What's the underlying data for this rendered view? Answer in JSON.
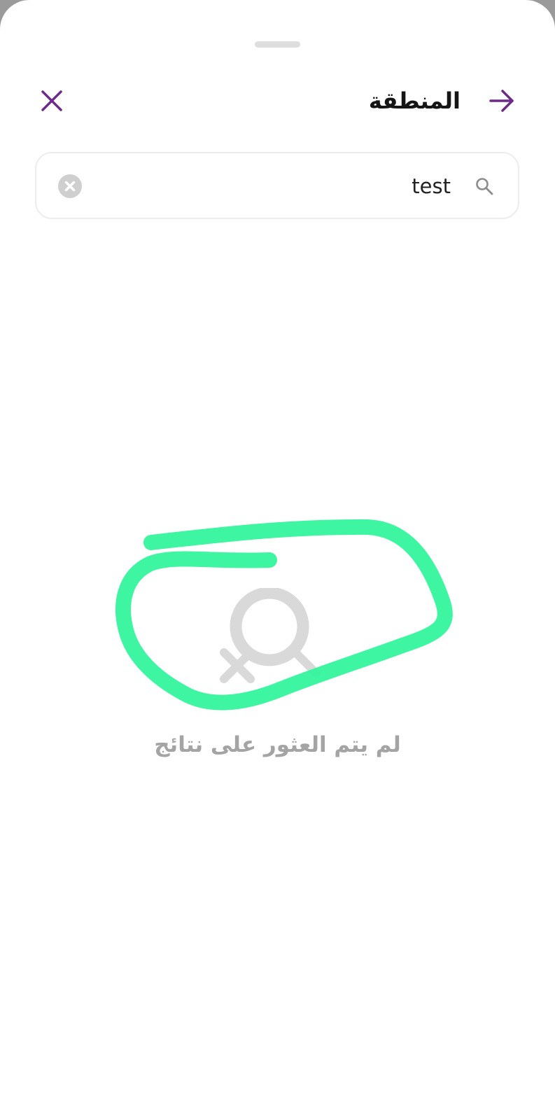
{
  "header": {
    "title": "المنطقة",
    "close_icon": "close-icon",
    "back_icon": "arrow-right-icon",
    "accent_color": "#6a2c86"
  },
  "search": {
    "value": "test",
    "search_icon": "search-icon",
    "clear_icon": "clear-circle-icon"
  },
  "empty_state": {
    "icon": "no-results-search-icon",
    "message": "لم يتم العثور على نتائج"
  },
  "annotation": {
    "icon": "highlight-scribble",
    "color": "#34f59c"
  }
}
